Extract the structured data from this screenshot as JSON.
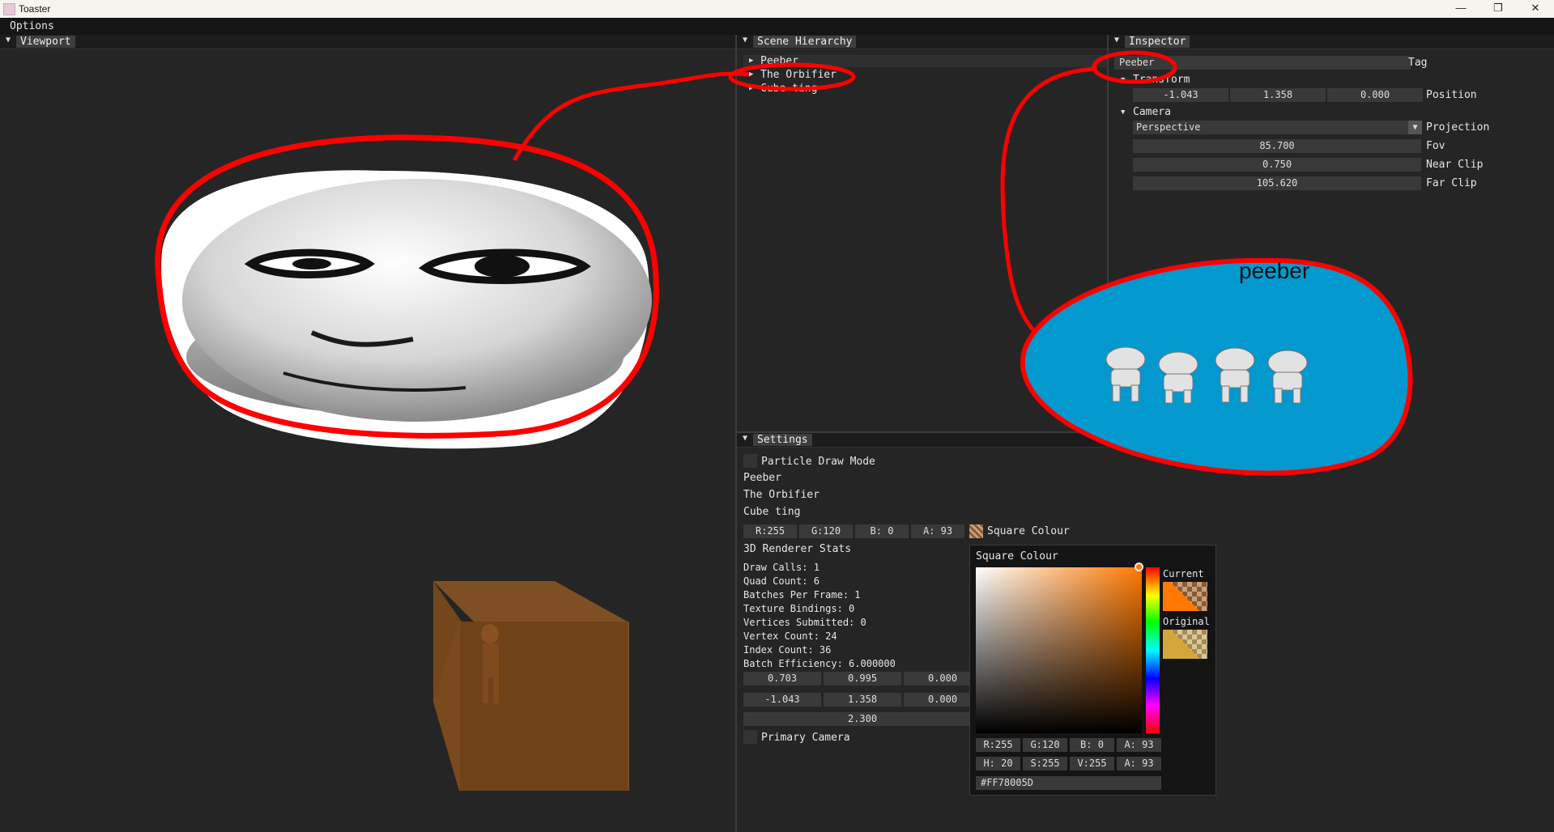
{
  "window": {
    "title": "Toaster",
    "minimize_glyph": "—",
    "maximize_glyph": "❐",
    "close_glyph": "✕"
  },
  "menu": {
    "options_label": "Options"
  },
  "viewport": {
    "tab_label": "Viewport"
  },
  "hierarchy": {
    "tab_label": "Scene Hierarchy",
    "items": [
      {
        "label": "Peeber"
      },
      {
        "label": "The Orbifier"
      },
      {
        "label": "Cube ting"
      }
    ]
  },
  "inspector": {
    "tab_label": "Inspector",
    "name_value": "Peeber",
    "tag_label": "Tag",
    "transform_label": "Transform",
    "position": {
      "x": "-1.043",
      "y": "1.358",
      "z": "0.000",
      "label": "Position"
    },
    "camera_label": "Camera",
    "projection": {
      "value": "Perspective",
      "label": "Projection",
      "arrow": "▼"
    },
    "fov": {
      "value": "85.700",
      "label": "Fov"
    },
    "near_clip": {
      "value": "0.750",
      "label": "Near Clip"
    },
    "far_clip": {
      "value": "105.620",
      "label": "Far Clip"
    },
    "annotation_text": "peeber"
  },
  "settings": {
    "tab_label": "Settings",
    "particle_draw_mode_label": "Particle Draw Mode",
    "entities": [
      "Peeber",
      "The Orbifier",
      "Cube ting"
    ],
    "square_colour": {
      "r": "R:255",
      "g": "G:120",
      "b": "B:  0",
      "a": "A: 93",
      "label": "Square Colour"
    },
    "stats_title": "3D Renderer Stats",
    "stats": [
      "Draw Calls:   1",
      "Quad Count:   6",
      "Batches Per Frame:  1",
      "Texture Bindings:  0",
      "Vertices Submitted: 0",
      "Vertex Count:   24",
      "Index Count:   36",
      "Batch Efficiency:  6.000000"
    ],
    "row1": [
      "0.703",
      "0.995",
      "0.000"
    ],
    "row2": [
      "-1.043",
      "1.358",
      "0.000"
    ],
    "row3": "2.300",
    "primary_camera_label": "Primary Camera"
  },
  "color_picker": {
    "title": "Square Colour",
    "current_label": "Current",
    "original_label": "Original",
    "rgba": [
      "R:255",
      "G:120",
      "B:  0",
      "A: 93"
    ],
    "hsva": [
      "H: 20",
      "S:255",
      "V:255",
      "A: 93"
    ],
    "hex": "#FF78005D",
    "current_color": "#ff7800",
    "original_color": "#d4a73a"
  },
  "colors": {
    "annotation_red": "#ff0000",
    "blob_blue": "#0399cf",
    "cube_orange": "#7a4a1e"
  }
}
